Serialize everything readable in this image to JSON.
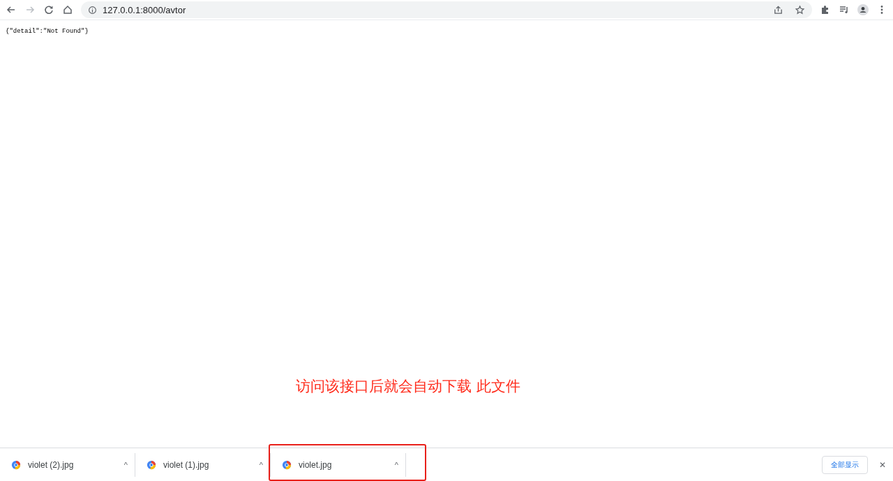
{
  "toolbar": {
    "url": "127.0.0.1:8000/avtor"
  },
  "page": {
    "body": "{\"detail\":\"Not Found\"}"
  },
  "annotation": {
    "text": "访问该接口后就会自动下载 此文件"
  },
  "downloads": {
    "items": [
      {
        "name": "violet (2).jpg",
        "caret": "^",
        "highlighted": false
      },
      {
        "name": "violet (1).jpg",
        "caret": "^",
        "highlighted": false
      },
      {
        "name": "violet.jpg",
        "caret": "^",
        "highlighted": true
      }
    ],
    "show_all": "全部显示",
    "close": "✕"
  }
}
